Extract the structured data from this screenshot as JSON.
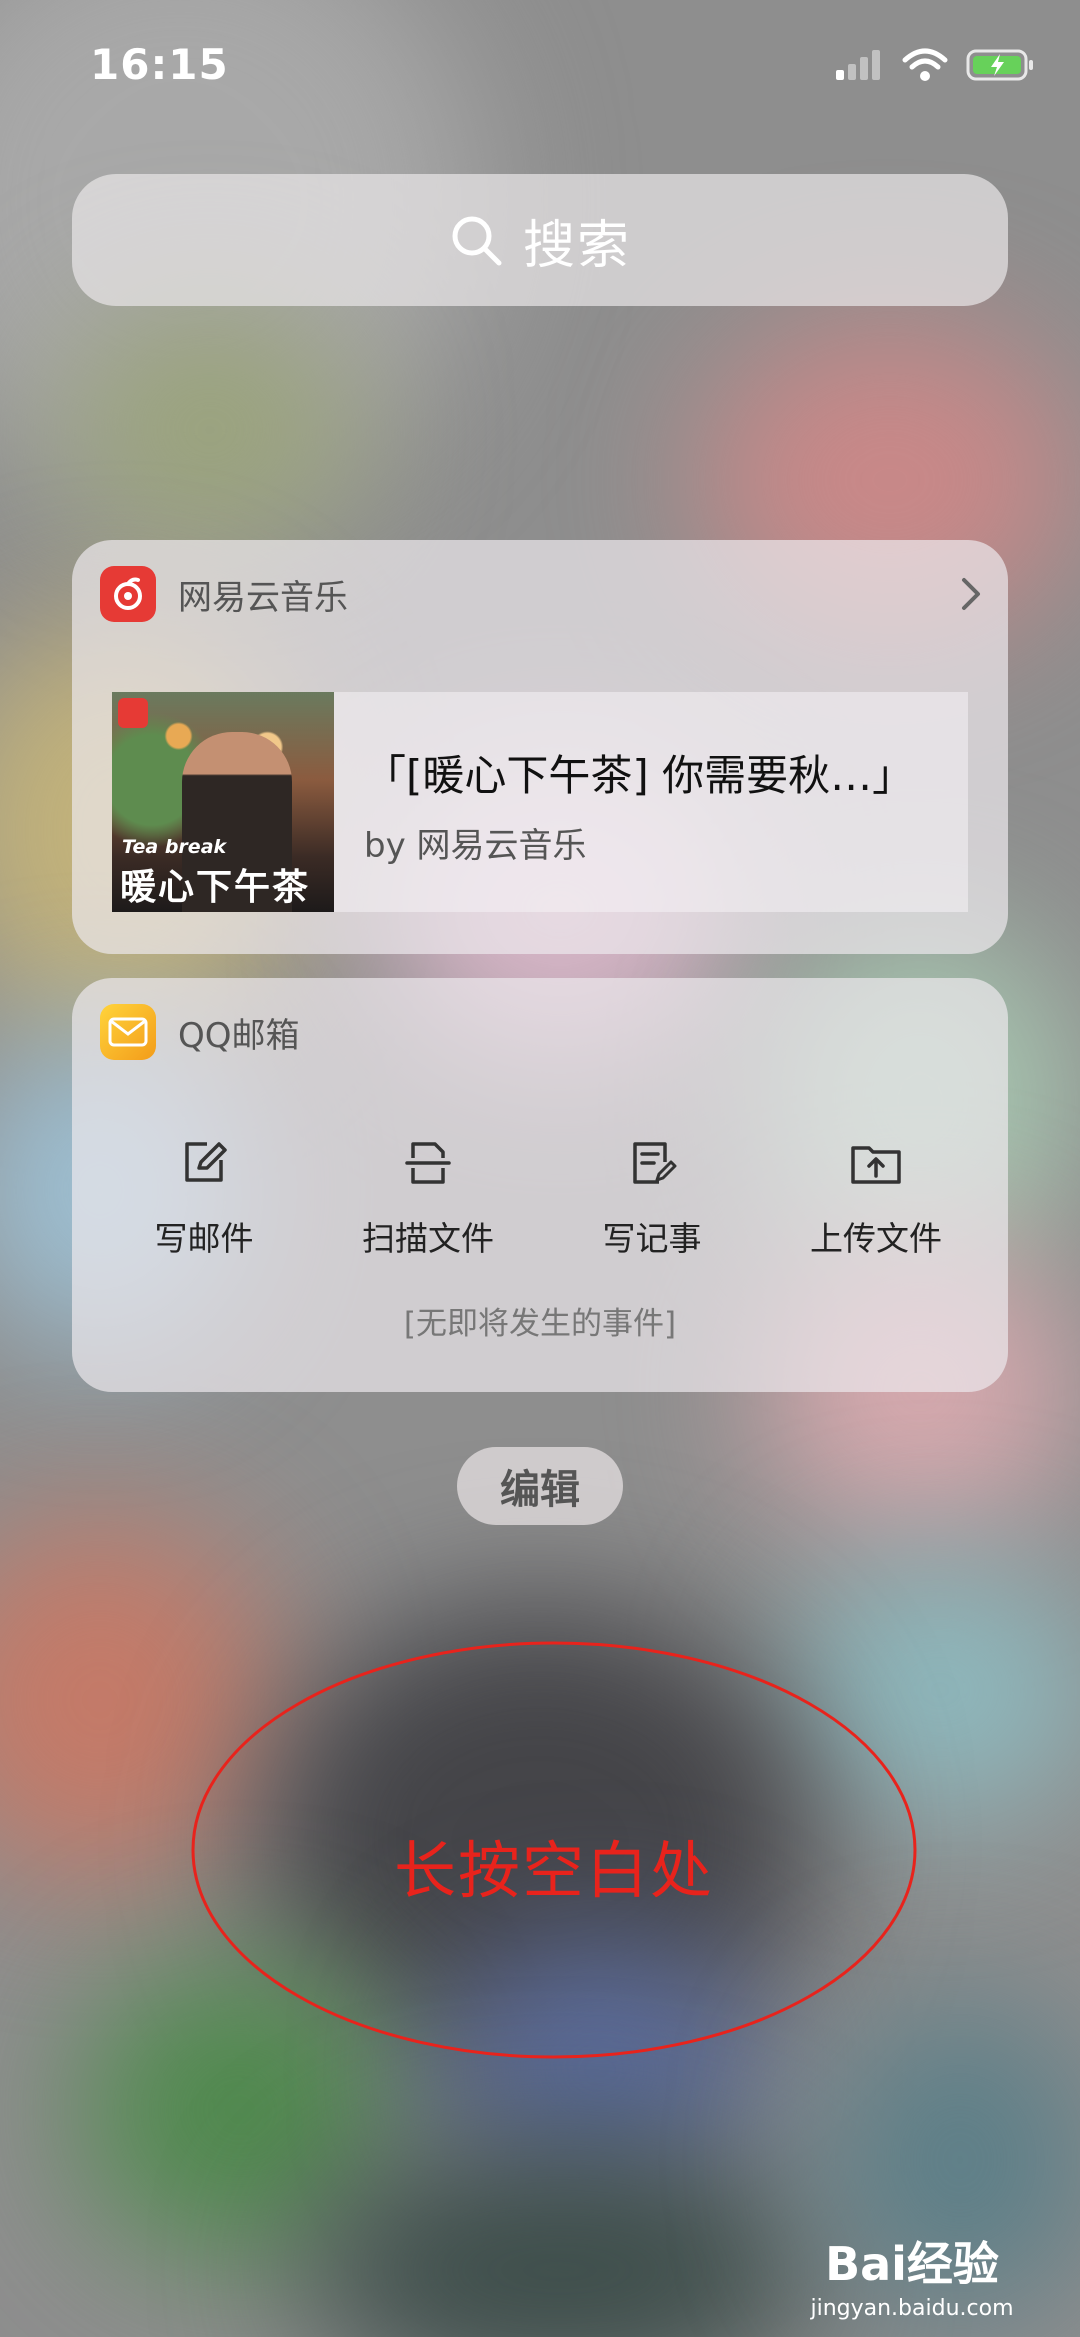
{
  "status_bar": {
    "time": "16:15"
  },
  "search": {
    "label": "搜索"
  },
  "music_widget": {
    "app_name": "网易云音乐",
    "cover_subtitle": "Tea break",
    "cover_title": "暖心下午茶",
    "song_title": "「[暖心下午茶] 你需要秋…」",
    "artist": "by 网易云音乐"
  },
  "mail_widget": {
    "app_name": "QQ邮箱",
    "actions": [
      {
        "label": "写邮件",
        "icon": "compose-icon"
      },
      {
        "label": "扫描文件",
        "icon": "scan-icon"
      },
      {
        "label": "写记事",
        "icon": "note-icon"
      },
      {
        "label": "上传文件",
        "icon": "upload-icon"
      }
    ],
    "events_text": "[无即将发生的事件]"
  },
  "edit_button": {
    "label": "编辑"
  },
  "annotation": {
    "text": "长按空白处",
    "color": "#e8231c"
  },
  "watermark": {
    "brand": "Bai经验",
    "url": "jingyan.baidu.com"
  },
  "colors": {
    "netease_red": "#e63a35",
    "qqmail_yellow": "#f5b324"
  }
}
